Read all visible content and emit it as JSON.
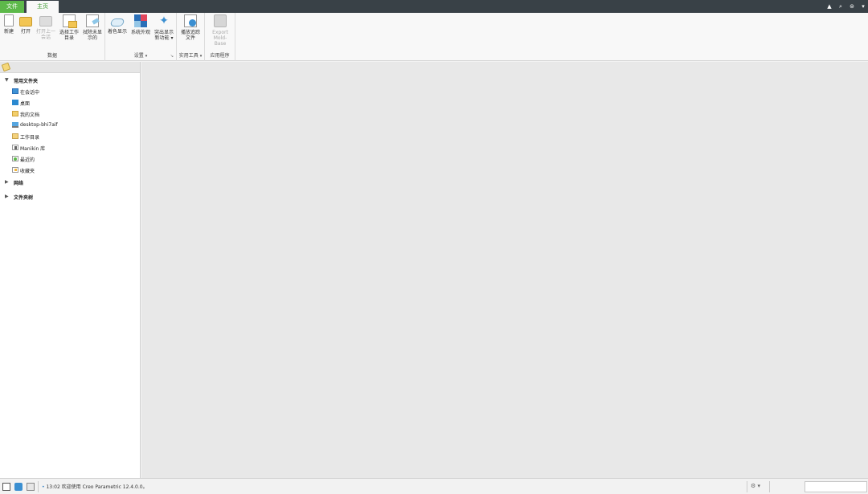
{
  "tabs": {
    "file": "文件",
    "home": "主页"
  },
  "ribbon": {
    "groups": {
      "data": {
        "title": "数据"
      },
      "settings": {
        "title": "设置"
      },
      "tools": {
        "title": "实用工具"
      },
      "apps": {
        "title": "应用程序"
      }
    },
    "buttons": {
      "new": "新建",
      "open": "打开",
      "open_last_1": "打开上一",
      "open_last_2": "会话",
      "select_workdir_1": "选择工作",
      "select_workdir_2": "目录",
      "erase_1": "拭除未显",
      "erase_2": "示的",
      "shaded_display": "着色显示",
      "system_appearance": "系统外观",
      "highlight_1": "突出显示",
      "highlight_2": "新功能",
      "play_trail_1": "播放追踪",
      "play_trail_2": "文件",
      "export_1": "Export",
      "export_2": "Mold­Base"
    }
  },
  "tree": {
    "common_folders": "常用文件夹",
    "items": [
      {
        "label": "在会话中",
        "icon": "session-icon"
      },
      {
        "label": "桌面",
        "icon": "desktop-icon"
      },
      {
        "label": "我的文档",
        "icon": "documents-icon"
      },
      {
        "label": "desktop-bhi7aif",
        "icon": "computer-icon"
      },
      {
        "label": "工作目录",
        "icon": "working-directory-icon"
      },
      {
        "label": "Manikin 库",
        "icon": "manikin-icon"
      },
      {
        "label": "最近的",
        "icon": "recent-icon"
      },
      {
        "label": "收藏夹",
        "icon": "favorites-icon"
      }
    ],
    "network": "网络",
    "folder_tree": "文件夹树"
  },
  "status": {
    "message": "13:02 欢迎使用 Creo Parametric 12.4.0.0。"
  },
  "colors": {
    "topbar": "#394147",
    "file_tab": "#5db94a",
    "canvas": "#e8e8e8"
  }
}
